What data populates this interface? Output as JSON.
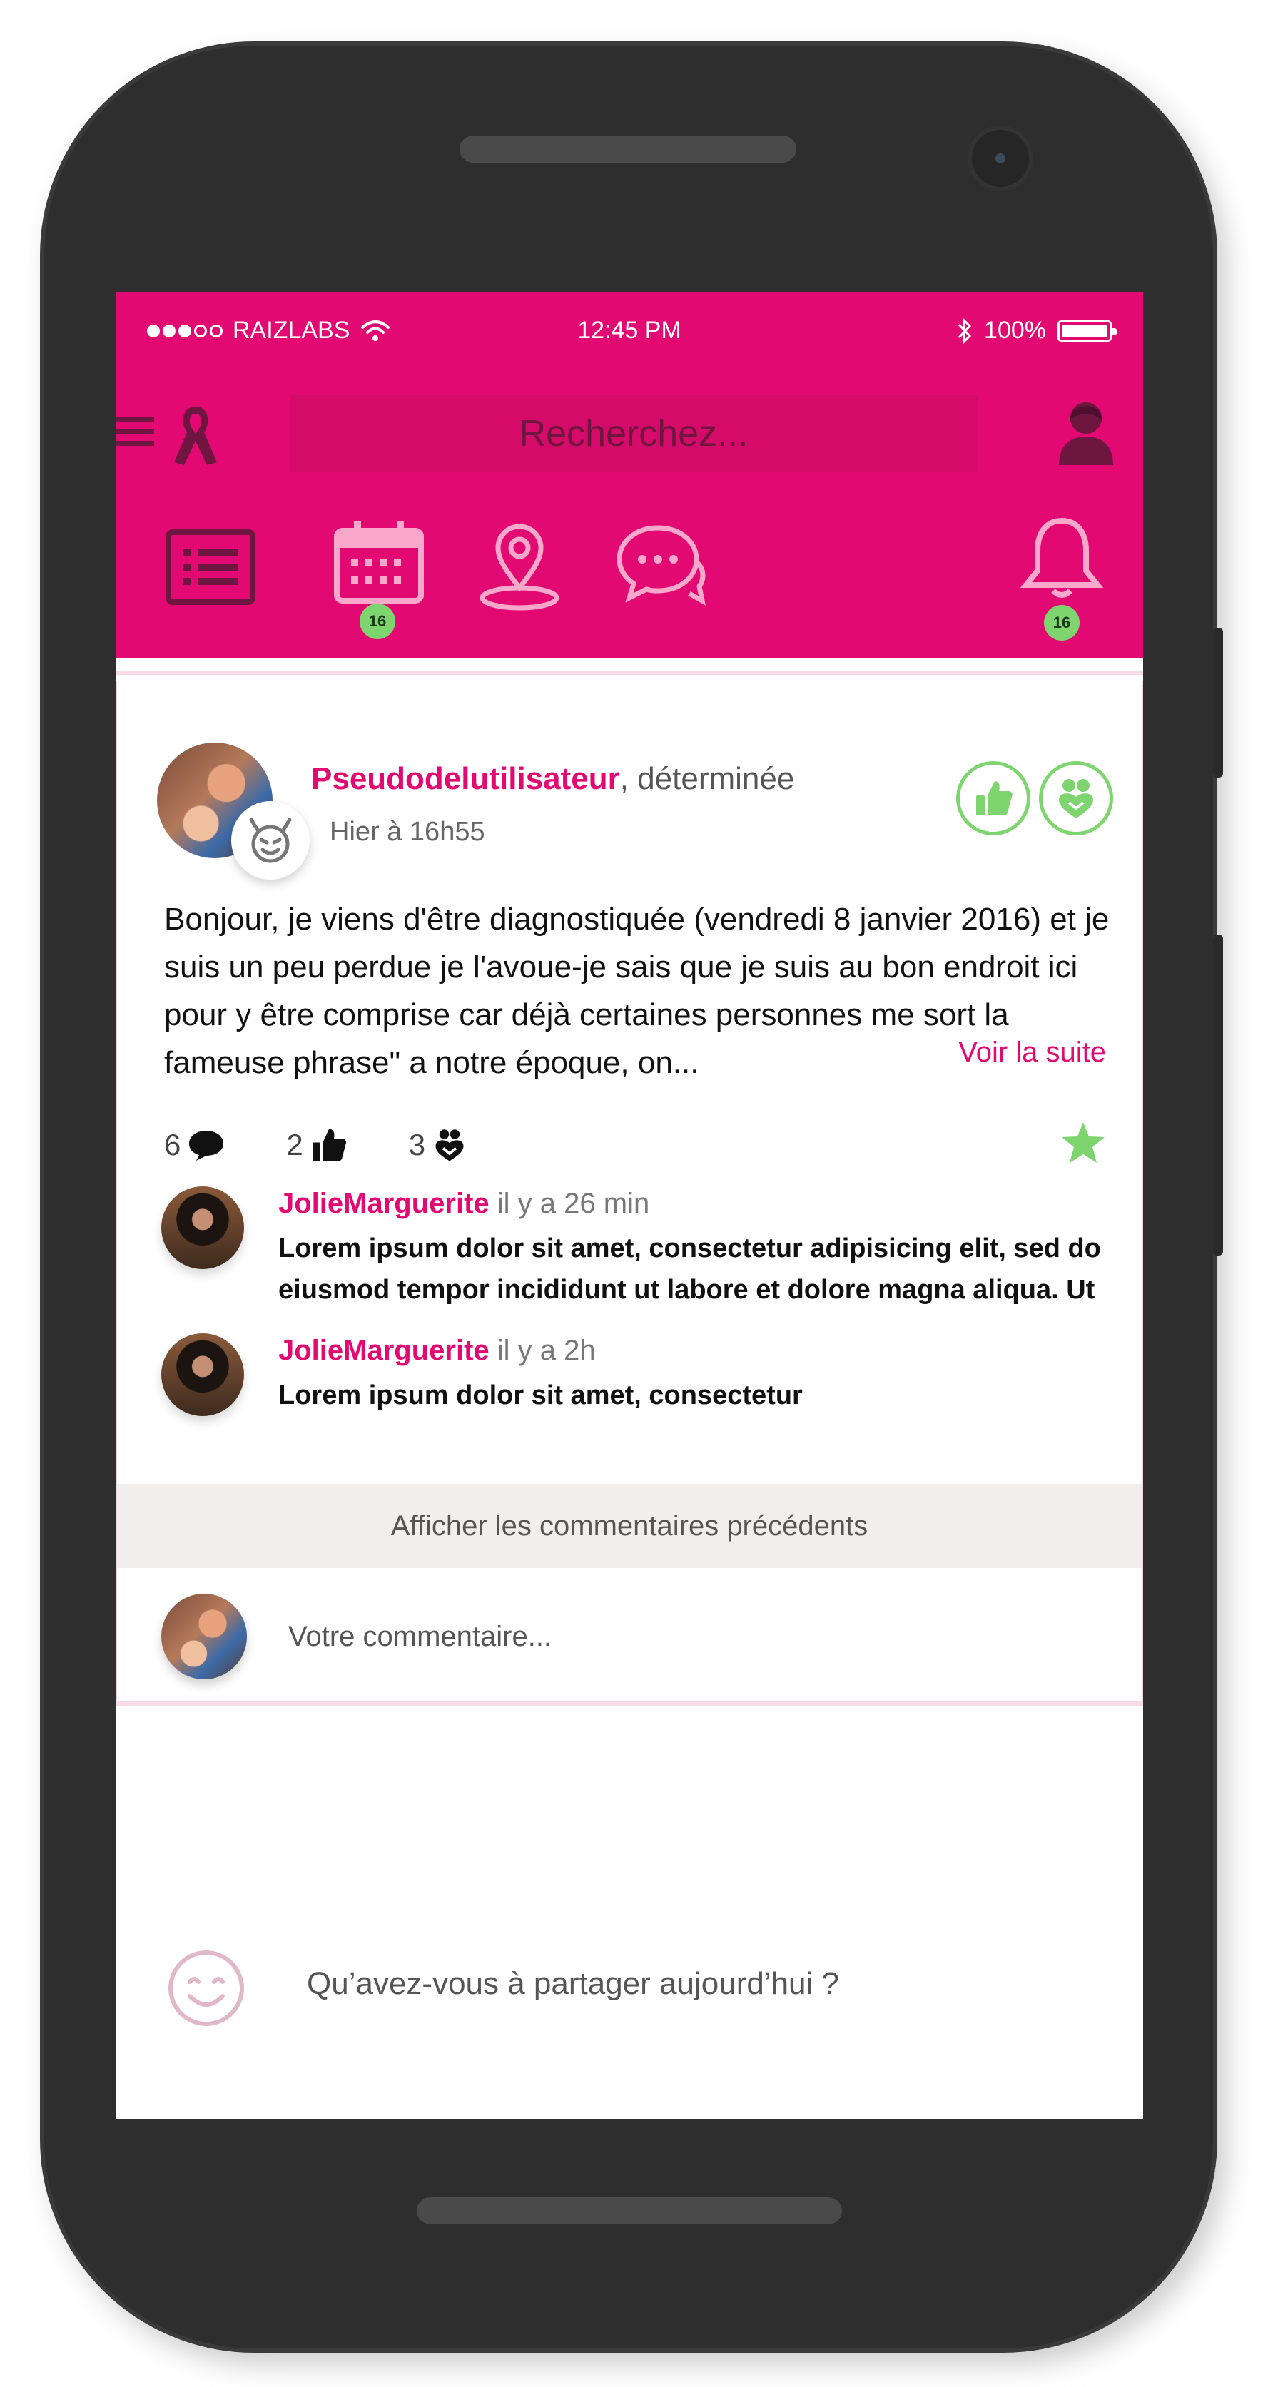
{
  "status_bar": {
    "carrier": "RAIZLABS",
    "time": "12:45 PM",
    "battery": "100%"
  },
  "toolbar": {
    "search_placeholder": "Recherchez..."
  },
  "nav": {
    "calendar_badge": "16",
    "notifications_badge": "16"
  },
  "post": {
    "username": "Pseudodelutilisateur",
    "status": ", déterminée",
    "time": "Hier à 16h55",
    "body": "Bonjour, je viens d'être diagnostiquée (vendredi 8 janvier 2016) et je suis un peu perdue je l'avoue-je sais que je suis au bon endroit ici pour y être comprise car déjà certaines personnes me sort la fameuse phrase\" a notre époque, on...",
    "see_more": "Voir la suite",
    "stats": {
      "comments": "6",
      "likes": "2",
      "hearts": "3"
    }
  },
  "comments": [
    {
      "author": "JolieMarguerite",
      "time": "il y a 26 min",
      "text": "Lorem ipsum dolor sit amet, consectetur adipisicing elit, sed do eiusmod tempor incididunt ut labore et dolore magna aliqua. Ut"
    },
    {
      "author": "JolieMarguerite",
      "time": "il y a 2h",
      "text": "Lorem ipsum dolor sit amet, consectetur"
    }
  ],
  "prev_comments_label": "Afficher les commentaires précédents",
  "compose_placeholder": "Votre commentaire...",
  "share_prompt": "Qu’avez-vous à partager aujourd’hui ?",
  "colors": {
    "brand_pink": "#e20a72",
    "accent_green": "#7ed56f",
    "dark_plum": "#6e1640"
  },
  "icons": [
    "menu-icon",
    "ribbon-icon",
    "profile-icon",
    "list-icon",
    "calendar-icon",
    "location-pin-icon",
    "chat-icon",
    "bell-icon",
    "devil-icon",
    "thumbs-up-icon",
    "hearts-icon",
    "speech-bubble-icon",
    "star-icon",
    "smiley-icon",
    "wifi-icon",
    "bluetooth-icon",
    "battery-icon"
  ]
}
